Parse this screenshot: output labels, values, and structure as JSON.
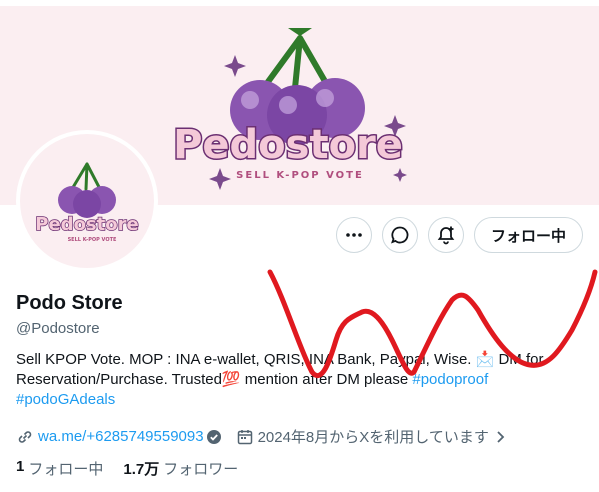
{
  "banner": {
    "logo_text": "Pedostore",
    "logo_subtext": "SELL K-POP VOTE",
    "brand_color": "#6b2f72",
    "bg_color": "#fbeef1"
  },
  "avatar": {
    "logo_text": "Pedostore",
    "logo_subtext": "SELL K-POP VOTE"
  },
  "actions": {
    "more_icon": "more-icon",
    "message_icon": "message-icon",
    "notify_icon": "notify-bell-icon",
    "follow_label": "フォロー中"
  },
  "profile": {
    "name": "Podo Store",
    "handle": "@Podostore",
    "bio_text": "Sell KPOP Vote. MOP : INA e-wallet, QRIS, INA Bank, Paypal, Wise. 📩 DM for Reservation/Purchase. Trusted💯 mention after DM please ",
    "bio_hashtag_1": "#podoproof",
    "bio_hashtag_2": "#podoGAdeals",
    "link": "wa.me/+6285749559093",
    "joined": "2024年8月からXを利用しています"
  },
  "stats": {
    "following_count": "1",
    "following_label": "フォロー中",
    "followers_count": "1.7万",
    "followers_label": "フォロワー"
  },
  "colors": {
    "link": "#1d9bf0",
    "text": "#0f1419",
    "secondary": "#536471",
    "annotation": "#e0191f"
  }
}
